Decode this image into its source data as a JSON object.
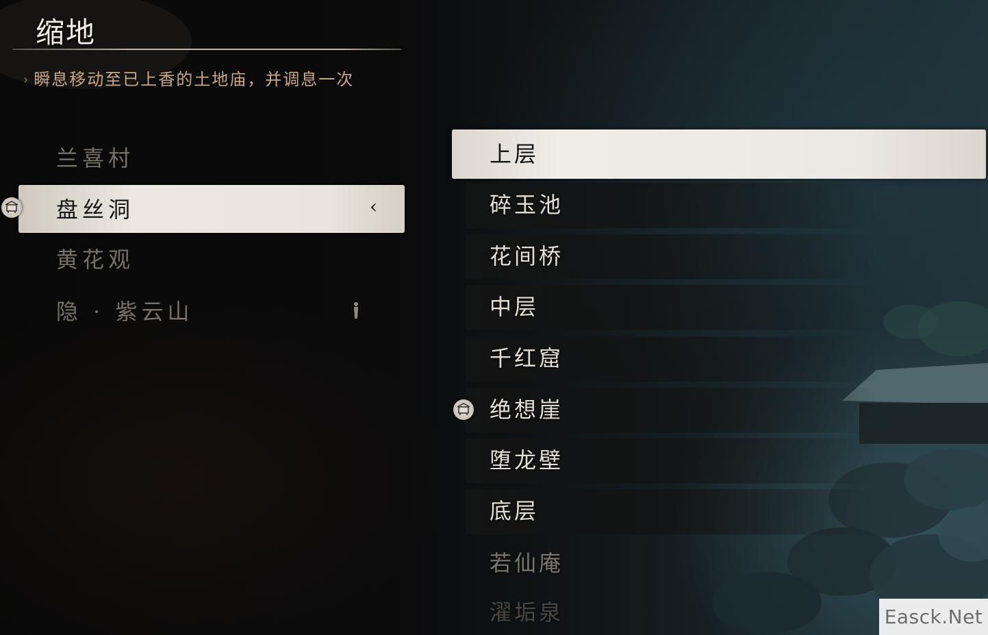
{
  "header": {
    "title": "缩地",
    "subtitle_arrow": "›",
    "subtitle": "瞬息移动至已上香的土地庙，并调息一次"
  },
  "regions": [
    {
      "label": "兰喜村",
      "selected": false
    },
    {
      "label": "盘丝洞",
      "selected": true,
      "chevron": "‹",
      "icon": "shrine-icon"
    },
    {
      "label": "黄花观",
      "selected": false
    },
    {
      "label": "隐 · 紫云山",
      "selected": false,
      "icon": "figure-icon"
    }
  ],
  "shrines": [
    {
      "label": "上层",
      "state": "selected"
    },
    {
      "label": "碎玉池",
      "state": "normal"
    },
    {
      "label": "花间桥",
      "state": "normal"
    },
    {
      "label": "中层",
      "state": "normal"
    },
    {
      "label": "千红窟",
      "state": "normal"
    },
    {
      "label": "绝想崖",
      "state": "normal",
      "icon": "shrine-icon"
    },
    {
      "label": "堕龙壁",
      "state": "normal"
    },
    {
      "label": "底层",
      "state": "normal"
    },
    {
      "label": "若仙庵",
      "state": "dim"
    },
    {
      "label": "濯垢泉",
      "state": "faint"
    }
  ],
  "watermark": "Easck.Net",
  "colors": {
    "selected_bg": "#ece8e1",
    "subtitle": "#c9a888",
    "inactive_text": "#75706a"
  }
}
